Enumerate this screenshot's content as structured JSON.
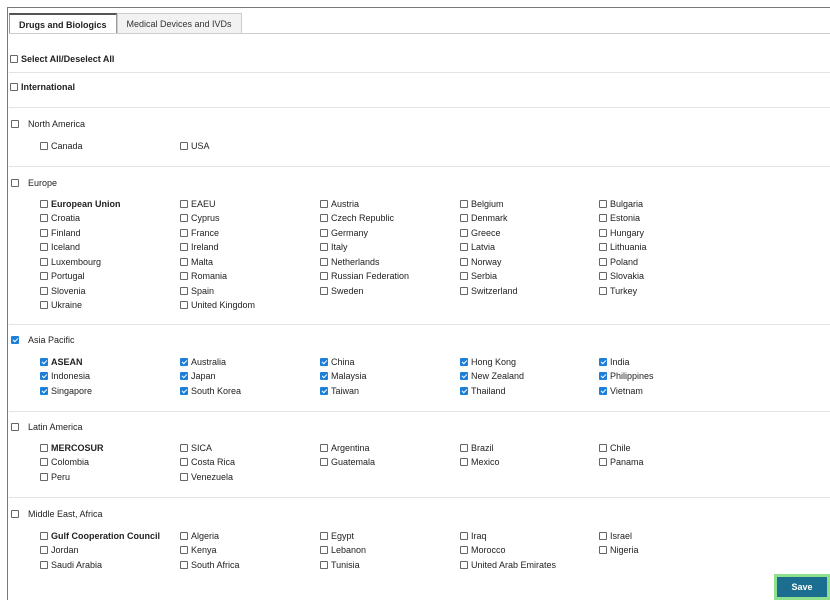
{
  "tabs": [
    "Drugs and Biologics",
    "Medical Devices and IVDs"
  ],
  "select_all": "Select All/Deselect All",
  "international": "International",
  "regions": {
    "north_america": {
      "label": "North America",
      "checked": false,
      "countries": [
        [
          "Canada",
          false
        ],
        [
          "USA",
          false
        ]
      ]
    },
    "europe": {
      "label": "Europe",
      "checked": false,
      "countries": [
        [
          "European Union",
          false
        ],
        [
          "EAEU",
          false
        ],
        [
          "Austria",
          false
        ],
        [
          "Belgium",
          false
        ],
        [
          "Bulgaria",
          false
        ],
        [
          "Croatia",
          false
        ],
        [
          "Cyprus",
          false
        ],
        [
          "Czech Republic",
          false
        ],
        [
          "Denmark",
          false
        ],
        [
          "Estonia",
          false
        ],
        [
          "Finland",
          false
        ],
        [
          "France",
          false
        ],
        [
          "Germany",
          false
        ],
        [
          "Greece",
          false
        ],
        [
          "Hungary",
          false
        ],
        [
          "Iceland",
          false
        ],
        [
          "Ireland",
          false
        ],
        [
          "Italy",
          false
        ],
        [
          "Latvia",
          false
        ],
        [
          "Lithuania",
          false
        ],
        [
          "Luxembourg",
          false
        ],
        [
          "Malta",
          false
        ],
        [
          "Netherlands",
          false
        ],
        [
          "Norway",
          false
        ],
        [
          "Poland",
          false
        ],
        [
          "Portugal",
          false
        ],
        [
          "Romania",
          false
        ],
        [
          "Russian Federation",
          false
        ],
        [
          "Serbia",
          false
        ],
        [
          "Slovakia",
          false
        ],
        [
          "Slovenia",
          false
        ],
        [
          "Spain",
          false
        ],
        [
          "Sweden",
          false
        ],
        [
          "Switzerland",
          false
        ],
        [
          "Turkey",
          false
        ],
        [
          "Ukraine",
          false
        ],
        [
          "United Kingdom",
          false
        ]
      ]
    },
    "asia_pacific": {
      "label": "Asia Pacific",
      "checked": true,
      "countries": [
        [
          "ASEAN",
          true
        ],
        [
          "Australia",
          true
        ],
        [
          "China",
          true
        ],
        [
          "Hong Kong",
          true
        ],
        [
          "India",
          true
        ],
        [
          "Indonesia",
          true
        ],
        [
          "Japan",
          true
        ],
        [
          "Malaysia",
          true
        ],
        [
          "New Zealand",
          true
        ],
        [
          "Philippines",
          true
        ],
        [
          "Singapore",
          true
        ],
        [
          "South Korea",
          true
        ],
        [
          "Taiwan",
          true
        ],
        [
          "Thailand",
          true
        ],
        [
          "Vietnam",
          true
        ]
      ]
    },
    "latin_america": {
      "label": "Latin America",
      "checked": false,
      "countries": [
        [
          "MERCOSUR",
          false
        ],
        [
          "SICA",
          false
        ],
        [
          "Argentina",
          false
        ],
        [
          "Brazil",
          false
        ],
        [
          "Chile",
          false
        ],
        [
          "Colombia",
          false
        ],
        [
          "Costa Rica",
          false
        ],
        [
          "Guatemala",
          false
        ],
        [
          "Mexico",
          false
        ],
        [
          "Panama",
          false
        ],
        [
          "Peru",
          false
        ],
        [
          "Venezuela",
          false
        ]
      ]
    },
    "middle_east_africa": {
      "label": "Middle East, Africa",
      "checked": false,
      "countries": [
        [
          "Gulf Cooperation Council",
          false
        ],
        [
          "Algeria",
          false
        ],
        [
          "Egypt",
          false
        ],
        [
          "Iraq",
          false
        ],
        [
          "Israel",
          false
        ],
        [
          "Jordan",
          false
        ],
        [
          "Kenya",
          false
        ],
        [
          "Lebanon",
          false
        ],
        [
          "Morocco",
          false
        ],
        [
          "Nigeria",
          false
        ],
        [
          "Saudi Arabia",
          false
        ],
        [
          "South Africa",
          false
        ],
        [
          "Tunisia",
          false
        ],
        [
          "United Arab Emirates",
          false
        ]
      ]
    }
  },
  "save_label": "Save"
}
